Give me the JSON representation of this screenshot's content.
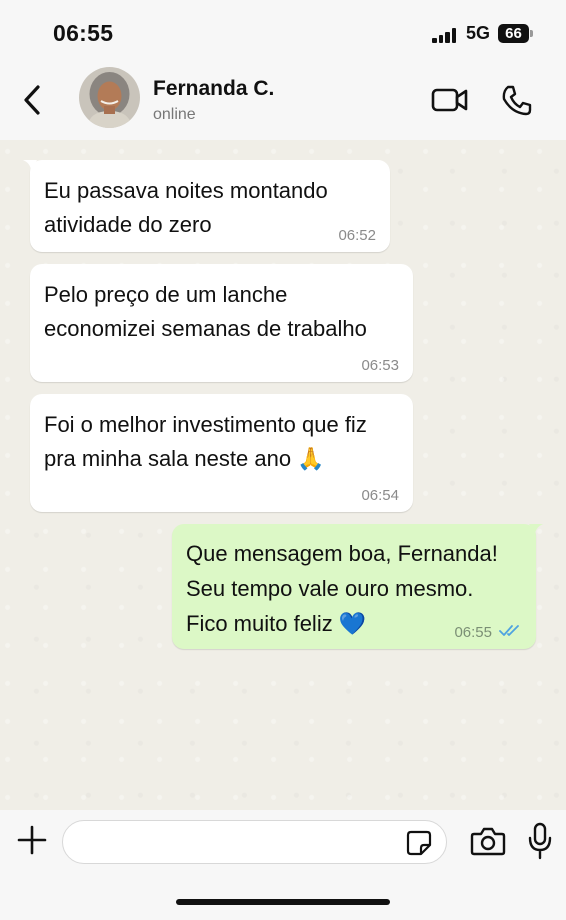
{
  "status_bar": {
    "time": "06:55",
    "network": "5G",
    "battery": "66"
  },
  "header": {
    "contact_name": "Fernanda C.",
    "contact_status": "online",
    "icons": [
      "back-icon",
      "video-call-icon",
      "voice-call-icon"
    ]
  },
  "messages": [
    {
      "direction": "incoming",
      "text": "Eu passava noites montando\natividade do zero",
      "time": "06:52"
    },
    {
      "direction": "incoming",
      "text": "Pelo preço de um lanche\neconomizei semanas de trabalho",
      "time": "06:53"
    },
    {
      "direction": "incoming",
      "text": "Foi o melhor investimento que fiz\npra minha sala neste ano 🙏",
      "time": "06:54"
    },
    {
      "direction": "outgoing",
      "text": "Que mensagem boa, Fernanda!\nSeu tempo vale ouro mesmo.\nFico muito feliz 💙",
      "time": "06:55",
      "status": "read"
    }
  ],
  "input": {
    "placeholder": "",
    "icons": [
      "plus-icon",
      "sticker-icon",
      "camera-icon",
      "mic-icon"
    ]
  },
  "colors": {
    "incoming_bubble": "#ffffff",
    "outgoing_bubble": "#dcf8c6",
    "read_ticks": "#4fa3e0",
    "chat_background": "#f0eee7"
  }
}
